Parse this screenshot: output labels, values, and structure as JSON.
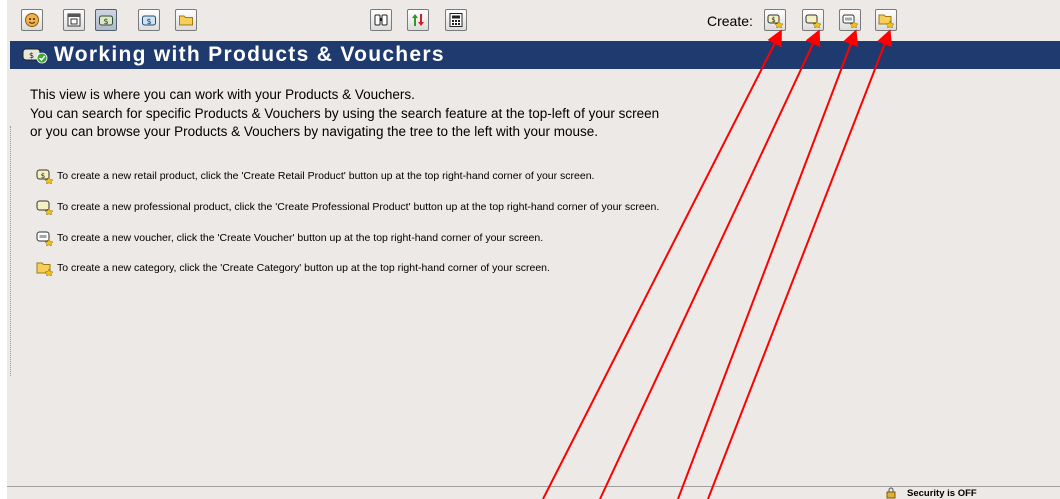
{
  "toolbar": {
    "left_buttons": [
      {
        "icon": "face-icon"
      },
      {
        "icon": "window-icon"
      },
      {
        "icon": "products-icon",
        "selected": true
      },
      {
        "icon": "vouchers-icon"
      },
      {
        "icon": "folder-icon"
      }
    ],
    "middle_buttons": [
      {
        "icon": "binoculars-icon"
      },
      {
        "icon": "sort-arrows-icon"
      },
      {
        "icon": "calculator-icon"
      }
    ],
    "create_label": "Create:",
    "create_buttons": [
      {
        "icon": "create-retail-product-icon"
      },
      {
        "icon": "create-professional-product-icon"
      },
      {
        "icon": "create-voucher-icon"
      },
      {
        "icon": "create-category-icon"
      }
    ]
  },
  "header": {
    "title": "Working with Products & Vouchers"
  },
  "intro": {
    "line1": "This view is where you can work with your Products & Vouchers.",
    "line2": "You can search for specific Products & Vouchers by using the search feature at the top-left of your screen",
    "line3": "or you can browse your Products & Vouchers by navigating the tree to the left with your mouse."
  },
  "instructions": [
    {
      "icon": "retail-product-icon",
      "text": "To create a new retail product, click the 'Create Retail Product' button up at the top right-hand corner of your screen."
    },
    {
      "icon": "professional-product-icon",
      "text": "To create a new professional product, click the 'Create Professional Product' button up at the top right-hand corner of your screen."
    },
    {
      "icon": "voucher-icon",
      "text": "To create a new voucher, click the 'Create Voucher' button up at the top right-hand corner of your screen."
    },
    {
      "icon": "category-icon",
      "text": "To create a new category, click the 'Create Category' button up at the top right-hand corner of your screen."
    }
  ],
  "status": {
    "security": "Security is OFF"
  },
  "colors": {
    "title_bar": "#1f3a6e",
    "annotation_arrows": "#ff0000",
    "background": "#ece9e6"
  }
}
